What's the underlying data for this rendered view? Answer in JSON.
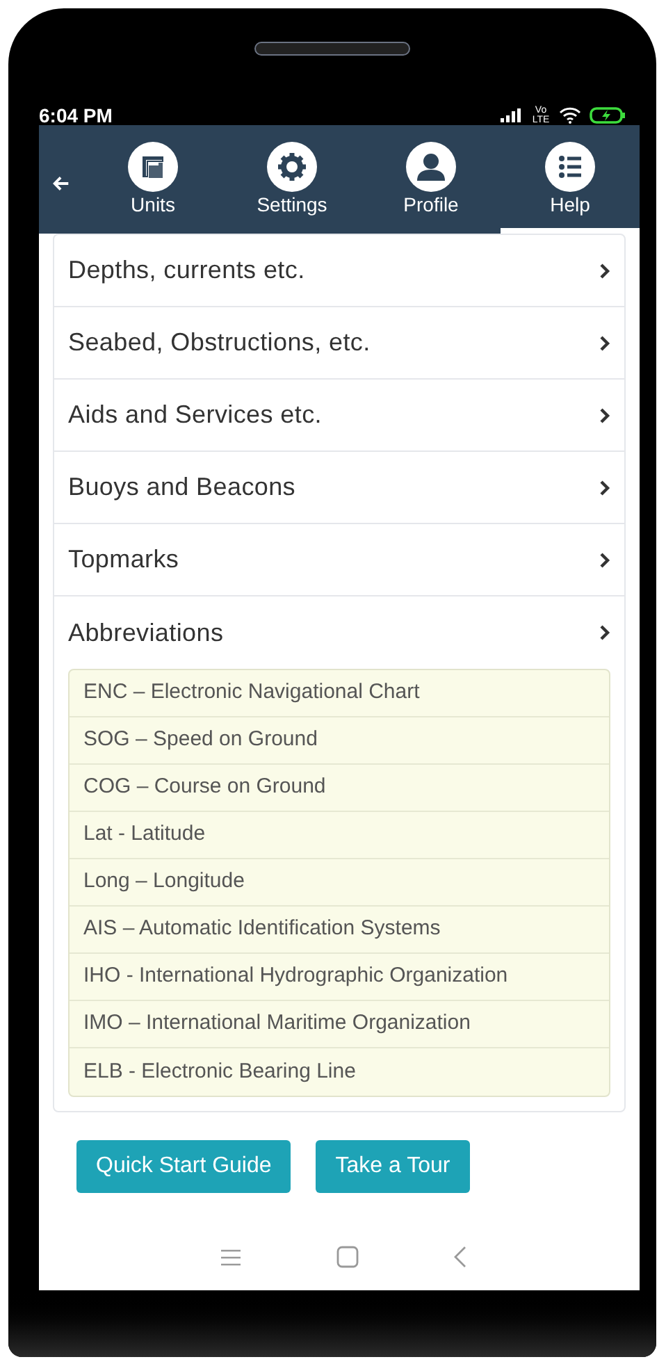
{
  "status_bar": {
    "time": "6:04 PM",
    "network": "Vo LTE"
  },
  "tabs": [
    {
      "kind": "units",
      "label": "Units",
      "selected": false
    },
    {
      "kind": "settings",
      "label": "Settings",
      "selected": false
    },
    {
      "kind": "profile",
      "label": "Profile",
      "selected": false
    },
    {
      "kind": "help",
      "label": "Help",
      "selected": true
    }
  ],
  "sections": [
    {
      "title": "Depths, currents etc.",
      "expanded": false
    },
    {
      "title": "Seabed, Obstructions, etc.",
      "expanded": false
    },
    {
      "title": "Aids and Services etc.",
      "expanded": false
    },
    {
      "title": "Buoys and Beacons",
      "expanded": false
    },
    {
      "title": "Topmarks",
      "expanded": false
    },
    {
      "title": "Abbreviations",
      "expanded": true,
      "items": [
        "ENC – Electronic Navigational Chart",
        "SOG – Speed on Ground",
        "COG – Course on Ground",
        "Lat - Latitude",
        "Long – Longitude",
        "AIS – Automatic Identification Systems",
        "IHO - International Hydrographic Organization",
        "IMO – International Maritime Organization",
        "ELB - Electronic Bearing Line"
      ]
    }
  ],
  "buttons": [
    "Quick Start Guide",
    "Take a Tour"
  ]
}
